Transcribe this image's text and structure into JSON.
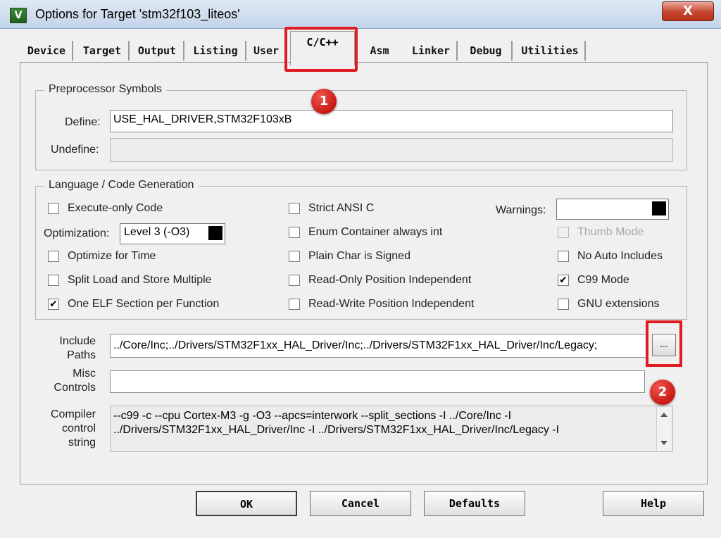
{
  "window": {
    "title": "Options for Target 'stm32f103_liteos'",
    "icon_letter": "V",
    "close_label": "X"
  },
  "tabs": [
    {
      "label": "Device"
    },
    {
      "label": "Target"
    },
    {
      "label": "Output"
    },
    {
      "label": "Listing"
    },
    {
      "label": "User"
    },
    {
      "label": "C/C++"
    },
    {
      "label": "Asm"
    },
    {
      "label": "Linker"
    },
    {
      "label": "Debug"
    },
    {
      "label": "Utilities"
    }
  ],
  "preprocessor": {
    "legend": "Preprocessor Symbols",
    "define_label": "Define:",
    "define_value": "USE_HAL_DRIVER,STM32F103xB",
    "undefine_label": "Undefine:",
    "undefine_value": ""
  },
  "language": {
    "legend": "Language / Code Generation",
    "execute_only": {
      "label": "Execute-only Code",
      "checked": false
    },
    "optimization_label": "Optimization:",
    "optimization_value": "Level 3 (-O3)",
    "optimize_for_time": {
      "label": "Optimize for Time",
      "checked": false
    },
    "split_load_store": {
      "label": "Split Load and Store Multiple",
      "checked": false
    },
    "one_elf_section": {
      "label": "One ELF Section per Function",
      "checked": true
    },
    "strict_ansi": {
      "label": "Strict ANSI C",
      "checked": false
    },
    "enum_container": {
      "label": "Enum Container always int",
      "checked": false
    },
    "plain_char_signed": {
      "label": "Plain Char is Signed",
      "checked": false
    },
    "readonly_pi": {
      "label": "Read-Only Position Independent",
      "checked": false
    },
    "readwrite_pi": {
      "label": "Read-Write Position Independent",
      "checked": false
    },
    "warnings_label": "Warnings:",
    "warnings_value": "",
    "thumb_mode": {
      "label": "Thumb Mode",
      "checked": false,
      "disabled": true
    },
    "no_auto_includes": {
      "label": "No Auto Includes",
      "checked": false
    },
    "c99_mode": {
      "label": "C99 Mode",
      "checked": true
    },
    "gnu_extensions": {
      "label": "GNU extensions",
      "checked": false
    }
  },
  "include": {
    "label_line1": "Include",
    "label_line2": "Paths",
    "value": "../Core/Inc;../Drivers/STM32F1xx_HAL_Driver/Inc;../Drivers/STM32F1xx_HAL_Driver/Inc/Legacy;",
    "browse_label": "..."
  },
  "misc": {
    "label_line1": "Misc",
    "label_line2": "Controls",
    "value": ""
  },
  "compiler": {
    "label_line1": "Compiler",
    "label_line2": "control",
    "label_line3": "string",
    "line1": "--c99 -c --cpu Cortex-M3 -g -O3 --apcs=interwork --split_sections -I ../Core/Inc -I",
    "line2": "../Drivers/STM32F1xx_HAL_Driver/Inc -I ../Drivers/STM32F1xx_HAL_Driver/Inc/Legacy -I"
  },
  "markers": {
    "one": "1",
    "two": "2"
  },
  "buttons": {
    "ok": "OK",
    "cancel": "Cancel",
    "defaults": "Defaults",
    "help": "Help"
  },
  "colors": {
    "highlight": "#e11b22",
    "dialog_bg": "#f0f0f0"
  }
}
